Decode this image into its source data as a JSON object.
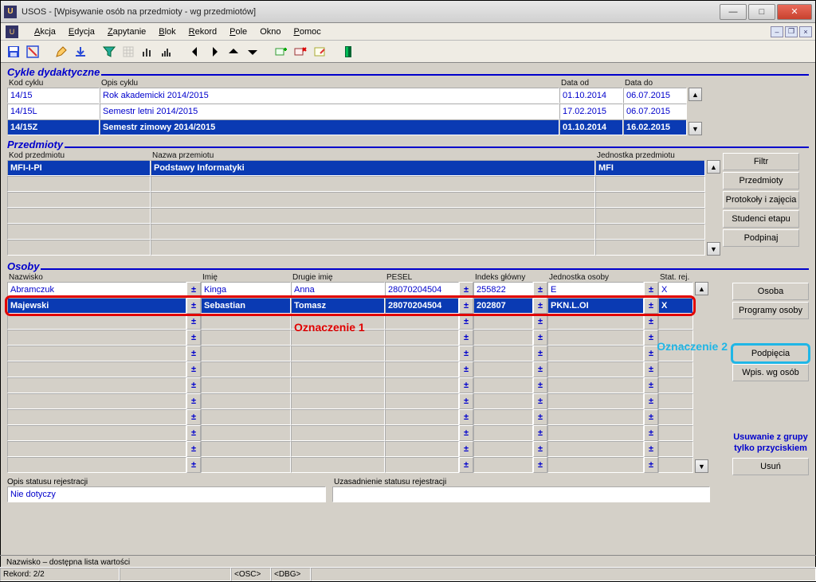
{
  "window": {
    "title": "USOS - [Wpisywanie osób na przedmioty - wg przedmiotów]"
  },
  "menus": {
    "akcja": "Akcja",
    "edycja": "Edycja",
    "zapytanie": "Zapytanie",
    "blok": "Blok",
    "rekord": "Rekord",
    "pole": "Pole",
    "okno": "Okno",
    "pomoc": "Pomoc"
  },
  "sections": {
    "cykle": "Cykle dydaktyczne",
    "przedmioty": "Przedmioty",
    "osoby": "Osoby"
  },
  "cykle": {
    "headers": {
      "kod": "Kod cyklu",
      "opis": "Opis cyklu",
      "od": "Data od",
      "do": "Data do"
    },
    "rows": [
      {
        "kod": "14/15",
        "opis": "Rok akademicki 2014/2015",
        "od": "01.10.2014",
        "do": "06.07.2015",
        "selected": false
      },
      {
        "kod": "14/15L",
        "opis": "Semestr letni 2014/2015",
        "od": "17.02.2015",
        "do": "06.07.2015",
        "selected": false
      },
      {
        "kod": "14/15Z",
        "opis": "Semestr zimowy 2014/2015",
        "od": "01.10.2014",
        "do": "16.02.2015",
        "selected": true
      }
    ]
  },
  "przedmioty": {
    "headers": {
      "kod": "Kod przedmiotu",
      "nazwa": "Nazwa przemiotu",
      "jedn": "Jednostka przedmiotu"
    },
    "rows": [
      {
        "kod": "MFI-I-PI",
        "nazwa": "Podstawy Informatyki",
        "jedn": "MFI",
        "selected": true
      }
    ],
    "buttons": {
      "filtr": "Filtr",
      "przedmioty": "Przedmioty",
      "protokoly": "Protokoły i zajęcia",
      "studenci": "Studenci etapu",
      "podpinaj": "Podpinaj"
    }
  },
  "osoby": {
    "headers": {
      "nazwisko": "Nazwisko",
      "imie": "Imię",
      "drugie": "Drugie imię",
      "pesel": "PESEL",
      "indeks": "Indeks główny",
      "jedn": "Jednostka osoby",
      "stat": "Stat. rej."
    },
    "rows": [
      {
        "nazwisko": "Abramczuk",
        "imie": "Kinga",
        "drugie": "Anna",
        "pesel": "28070204504",
        "indeks": "255822",
        "jedn": "E",
        "stat": "X",
        "selected": false,
        "highlight": false
      },
      {
        "nazwisko": "Majewski",
        "imie": "Sebastian",
        "drugie": "Tomasz",
        "pesel": "28070204504",
        "indeks": "202807",
        "jedn": "PKN.L.OI",
        "stat": "X",
        "selected": true,
        "highlight": true
      }
    ],
    "buttons": {
      "osoba": "Osoba",
      "programy": "Programy osoby",
      "podpiecia": "Podpięcia",
      "wpis": "Wpis. wg osób",
      "usun": "Usuń"
    },
    "note1": "Usuwanie z grupy",
    "note2": "tylko przyciskiem"
  },
  "status": {
    "opis_label": "Opis statusu rejestracji",
    "opis_value": "Nie dotyczy",
    "uzas_label": "Uzasadnienie statusu rejestracji",
    "uzas_value": "",
    "hint": "Nazwisko – dostępna lista wartości",
    "rekord": "Rekord: 2/2",
    "osc": "<OSC>",
    "dbg": "<DBG>"
  },
  "annotations": {
    "ozn1": "Oznaczenie 1",
    "ozn2": "Oznaczenie 2"
  }
}
